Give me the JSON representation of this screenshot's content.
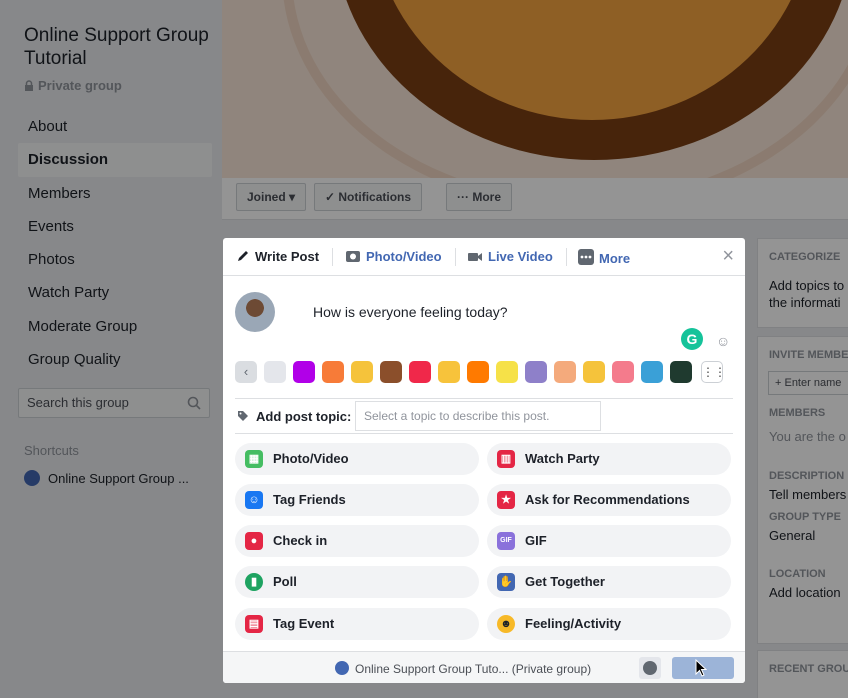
{
  "group": {
    "title": "Online Support Group Tutorial",
    "privacy": "Private group"
  },
  "nav": {
    "items": [
      {
        "label": "About"
      },
      {
        "label": "Discussion",
        "active": true
      },
      {
        "label": "Members"
      },
      {
        "label": "Events"
      },
      {
        "label": "Photos"
      },
      {
        "label": "Watch Party"
      },
      {
        "label": "Moderate Group"
      },
      {
        "label": "Group Quality"
      }
    ]
  },
  "search": {
    "placeholder": "Search this group"
  },
  "shortcuts": {
    "label": "Shortcuts",
    "items": [
      {
        "label": "Online Support Group ..."
      }
    ]
  },
  "cover_actions": {
    "joined": "Joined ▾",
    "notifications": "✓ Notifications",
    "more": "··· More"
  },
  "right_sidebar": {
    "categorize_header": "CATEGORIZE",
    "categorize_text_1": "Add topics to",
    "categorize_text_2": "the informati",
    "invite_header": "INVITE MEMBE",
    "invite_placeholder": "+ Enter name",
    "members_header": "MEMBERS",
    "members_text": "You are the o",
    "description_header": "DESCRIPTION",
    "description_text": "Tell members",
    "group_type_header": "GROUP TYPE",
    "group_type_value": "General",
    "location_header": "LOCATION",
    "location_value": "Add location",
    "recent_header": "RECENT GROU"
  },
  "composer": {
    "tabs": [
      {
        "label": "Write Post",
        "icon": "pencil-icon",
        "active": true
      },
      {
        "label": "Photo/Video",
        "icon": "camera-icon"
      },
      {
        "label": "Live Video",
        "icon": "video-camera-icon"
      },
      {
        "label": "More",
        "icon": "more-dots-icon"
      }
    ],
    "post_text": "How is everyone feeling today?",
    "grammarly_letter": "G",
    "swatch_colors": [
      "#e4e6eb",
      "#b100e8",
      "#f77b38",
      "#f5c33b",
      "#8b4f2b",
      "#f0284a",
      "#f7c33b",
      "#ff7a00",
      "#f6e148",
      "#8e80c9",
      "#f4aa7c",
      "#f5c33b",
      "#f47b8c",
      "#3aa0d7",
      "#1f3a2f"
    ],
    "add_topic_label": "Add post topic:",
    "topic_placeholder": "Select a topic to describe this post.",
    "options": [
      {
        "label": "Photo/Video",
        "icon": "photo-icon",
        "color": "#45bd62"
      },
      {
        "label": "Watch Party",
        "icon": "popcorn-icon",
        "color": "#e42645"
      },
      {
        "label": "Tag Friends",
        "icon": "tag-friends-icon",
        "color": "#1877f2"
      },
      {
        "label": "Ask for Recommendations",
        "icon": "star-bubble-icon",
        "color": "#e42645"
      },
      {
        "label": "Check in",
        "icon": "location-pin-icon",
        "color": "#e42645"
      },
      {
        "label": "GIF",
        "icon": "gif-icon",
        "color": "#8a71db"
      },
      {
        "label": "Poll",
        "icon": "poll-icon",
        "color": "#1ea361"
      },
      {
        "label": "Get Together",
        "icon": "hand-wave-icon",
        "color": "#4267b2"
      },
      {
        "label": "Tag Event",
        "icon": "calendar-icon",
        "color": "#e42645"
      },
      {
        "label": "Feeling/Activity",
        "icon": "smile-icon",
        "color": "#f7b928"
      }
    ],
    "footer_group": "Online Support Group Tuto...  (Private group)"
  }
}
